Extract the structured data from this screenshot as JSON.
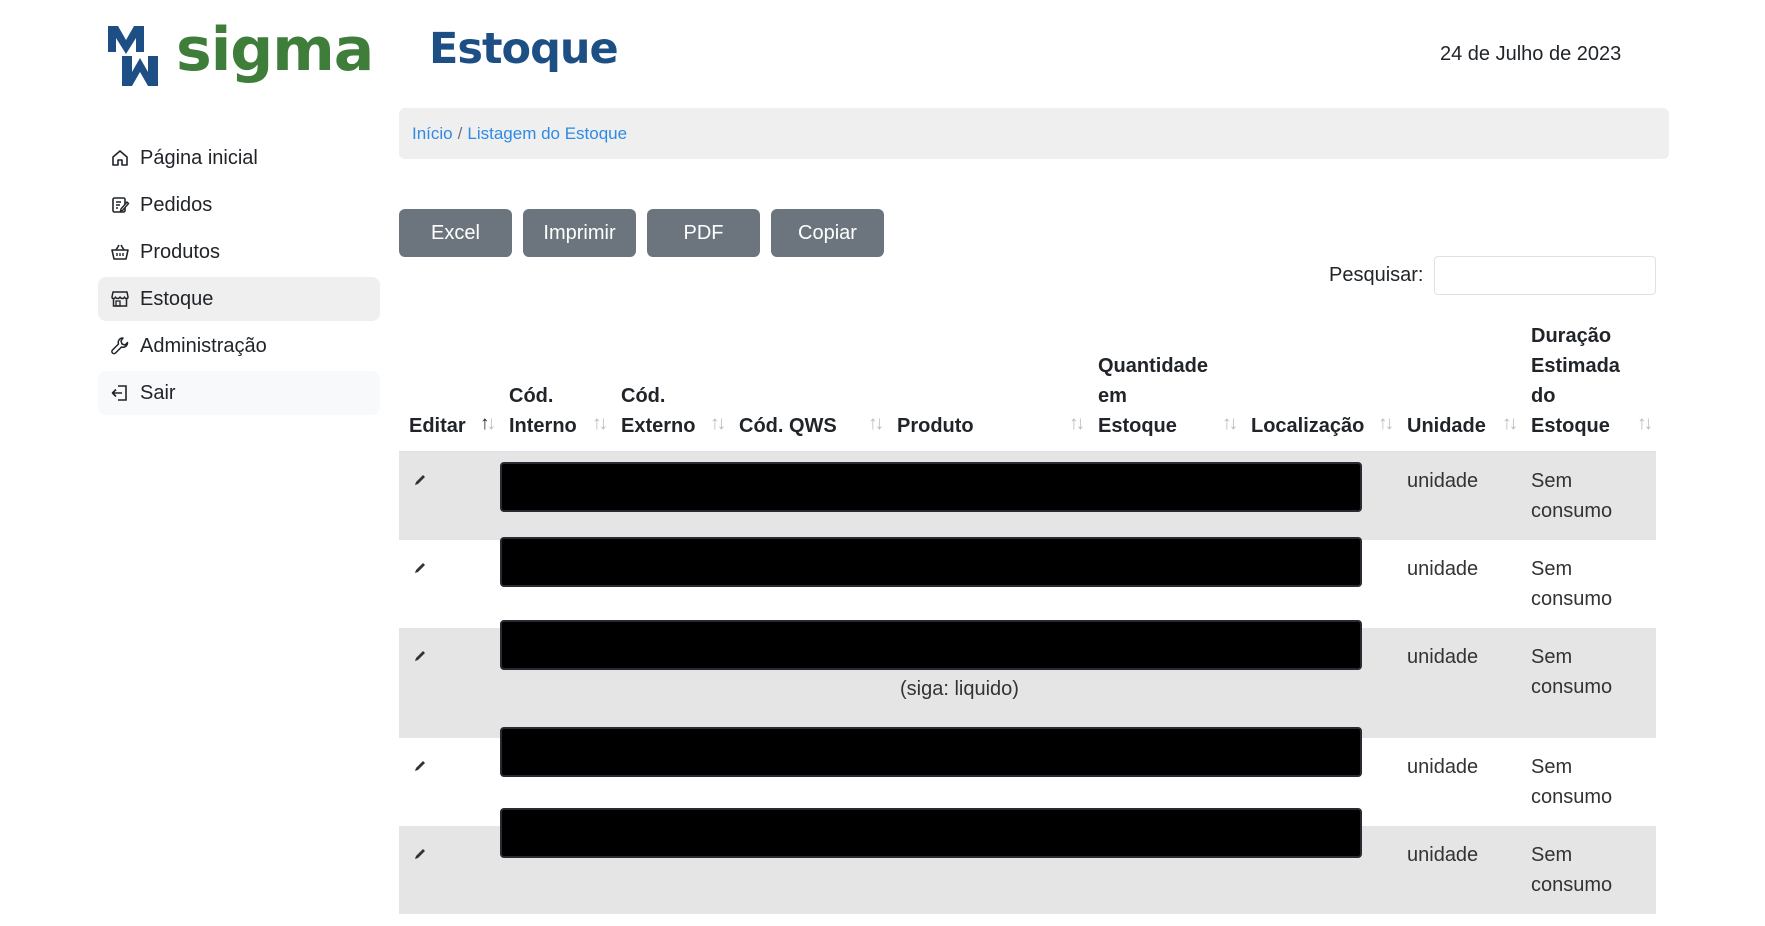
{
  "brand": {
    "name": "sigma",
    "color_primary": "#1d4f84",
    "color_secondary": "#3f7e3a"
  },
  "header": {
    "title": "Estoque",
    "date": "24 de Julho de 2023"
  },
  "sidebar": {
    "items": [
      {
        "label": "Página inicial",
        "icon": "home-icon"
      },
      {
        "label": "Pedidos",
        "icon": "edit-note-icon"
      },
      {
        "label": "Produtos",
        "icon": "basket-icon"
      },
      {
        "label": "Estoque",
        "icon": "shop-icon",
        "active": true
      },
      {
        "label": "Administração",
        "icon": "wrench-icon"
      },
      {
        "label": "Sair",
        "icon": "logout-icon"
      }
    ]
  },
  "breadcrumb": {
    "home": "Início",
    "separator": "/",
    "current": "Listagem do Estoque"
  },
  "toolbar": {
    "excel": "Excel",
    "print": "Imprimir",
    "pdf": "PDF",
    "copy": "Copiar"
  },
  "search": {
    "label": "Pesquisar:",
    "value": ""
  },
  "table": {
    "columns": [
      {
        "line1": "",
        "line2": "",
        "line3": "",
        "line4": "Editar"
      },
      {
        "line1": "",
        "line2": "",
        "line3": "Cód.",
        "line4": "Interno"
      },
      {
        "line1": "",
        "line2": "",
        "line3": "Cód.",
        "line4": "Externo"
      },
      {
        "line1": "",
        "line2": "",
        "line3": "",
        "line4": "Cód. QWS"
      },
      {
        "line1": "",
        "line2": "",
        "line3": "",
        "line4": "Produto"
      },
      {
        "line1": "",
        "line2": "Quantidade",
        "line3": "em",
        "line4": "Estoque"
      },
      {
        "line1": "",
        "line2": "",
        "line3": "",
        "line4": "Localização"
      },
      {
        "line1": "",
        "line2": "",
        "line3": "",
        "line4": "Unidade"
      },
      {
        "line1": "Duração",
        "line2": "Estimada",
        "line3": "do",
        "line4": "Estoque"
      }
    ],
    "sort_glyph": "↑↓",
    "rows": [
      {
        "unit": "unidade",
        "duration_line1": "Sem",
        "duration_line2": "consumo"
      },
      {
        "unit": "unidade",
        "duration_line1": "Sem",
        "duration_line2": "consumo"
      },
      {
        "unit": "unidade",
        "duration_line1": "Sem",
        "duration_line2": "consumo"
      },
      {
        "unit": "unidade",
        "duration_line1": "Sem",
        "duration_line2": "consumo"
      },
      {
        "unit": "unidade",
        "duration_line1": "Sem",
        "duration_line2": "consumo"
      }
    ],
    "row3_extra": "(siga: liquido)"
  }
}
